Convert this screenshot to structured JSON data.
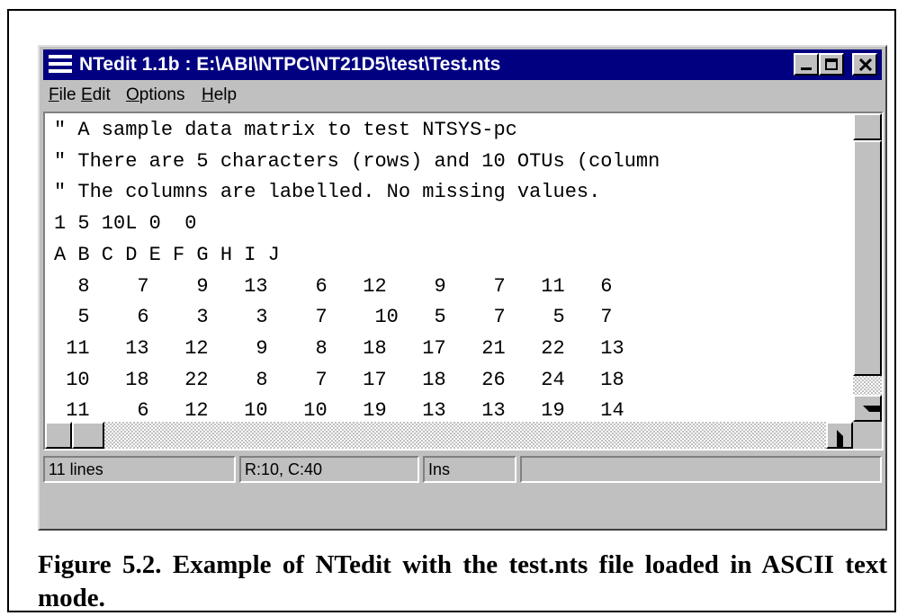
{
  "window": {
    "title": "NTedit 1.1b : E:\\ABI\\NTPC\\NT21D5\\test\\Test.nts"
  },
  "menu": {
    "items": [
      {
        "key": "F",
        "rest": "ile"
      },
      {
        "key": "E",
        "rest": "dit"
      },
      {
        "key": "O",
        "rest": "ptions"
      },
      {
        "key": "H",
        "rest": "elp"
      }
    ]
  },
  "editor": {
    "lines": [
      "\" A sample data matrix to test NTSYS-pc",
      "\" There are 5 characters (rows) and 10 OTUs (column",
      "\" The columns are labelled. No missing values.",
      "1 5 10L 0  0",
      "A B C D E F G H I J",
      "  8    7    9   13    6   12    9    7   11   6",
      "  5    6    3    3    7    10   5    7    5   7",
      " 11   13   12    9    8   18   17   21   22   13",
      " 10   18   22    8    7   17   18   26   24   18",
      " 11    6   12   10   10   19   13   13   19   14"
    ]
  },
  "status": {
    "lines": "11 lines",
    "position": "R:10, C:40",
    "mode": "Ins",
    "extra": ""
  },
  "caption": "Figure 5.2. Example of NTedit with the test.nts file loaded in ASCII text mode."
}
